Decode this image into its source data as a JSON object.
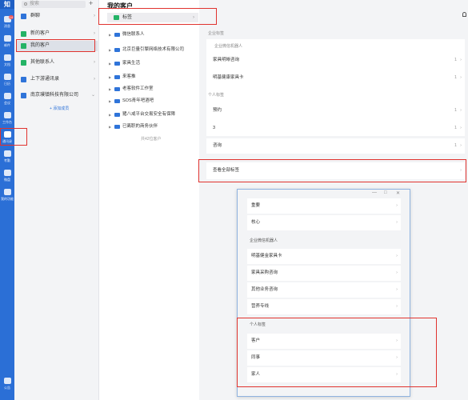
{
  "rail": {
    "logo": "知",
    "badge": "14",
    "items": [
      {
        "label": "消息"
      },
      {
        "label": "邮件"
      },
      {
        "label": "文档"
      },
      {
        "label": "日历"
      },
      {
        "label": "会议"
      },
      {
        "label": "工作台"
      },
      {
        "label": "通讯录"
      },
      {
        "label": "考勤"
      },
      {
        "label": "微盘"
      },
      {
        "label": "我的功能"
      },
      {
        "label": "公告"
      }
    ]
  },
  "search": {
    "placeholder": "搜索"
  },
  "nav": [
    {
      "label": "群聊"
    },
    {
      "label": "新的客户"
    },
    {
      "label": "我的客户"
    },
    {
      "label": "其他联系人"
    },
    {
      "label": "上下游通讯录"
    },
    {
      "label": "南京璞镇科技有限公司"
    }
  ],
  "add_link": "+ 添加成员",
  "main": {
    "title": "我的客户",
    "tag_row": "标签",
    "customers": [
      "微信联系人",
      "北京巨量引擎网络技术有限公司",
      "家具生活",
      "来客推",
      "老客软件工作室",
      "SOS青年吧酒吧",
      "猪八戒平台交易安全有保障",
      "已离职的商务伙伴"
    ],
    "count": "共42位客户"
  },
  "panel": {
    "sec_company": "企业标签",
    "sub_company": "企业微信机器人",
    "company_items": [
      {
        "label": "家具明晰咨询",
        "count": "1"
      },
      {
        "label": "明基健康家具卡",
        "count": "1"
      }
    ],
    "sec_personal": "个人标签",
    "personal_items": [
      {
        "label": "预约",
        "count": "1"
      },
      {
        "label": "3",
        "count": "1"
      },
      {
        "label": "咨询",
        "count": "1"
      }
    ],
    "view_all": "查看全部标签"
  },
  "popup": {
    "controls": [
      "—",
      "□",
      "✕"
    ],
    "top_items": [
      "重要",
      "核心"
    ],
    "sub_company": "企业微信机器人",
    "company_items": [
      "明基健金家具卡",
      "家具采购咨询",
      "其他业务咨询",
      "营养专线"
    ],
    "sec_personal": "个人标签",
    "personal_items": [
      "客户",
      "同事",
      "家人"
    ]
  }
}
